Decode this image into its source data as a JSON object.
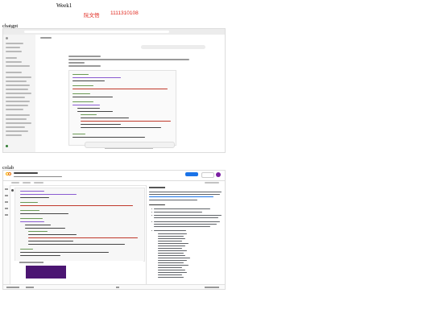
{
  "header": {
    "week": "Week1",
    "author": "阮文悟",
    "student_id": "1111310108"
  },
  "sections": {
    "chatgpt": "chatgpt",
    "colab": "colab"
  },
  "colors": {
    "header_red": "#e0261c",
    "colab_share_blue": "#1a73e8",
    "output_purple": "#4b1572"
  },
  "chatgpt_screenshot": {
    "icon": "chatgpt-interface-screenshot"
  },
  "colab_screenshot": {
    "icon": "colab-notebook-screenshot"
  }
}
